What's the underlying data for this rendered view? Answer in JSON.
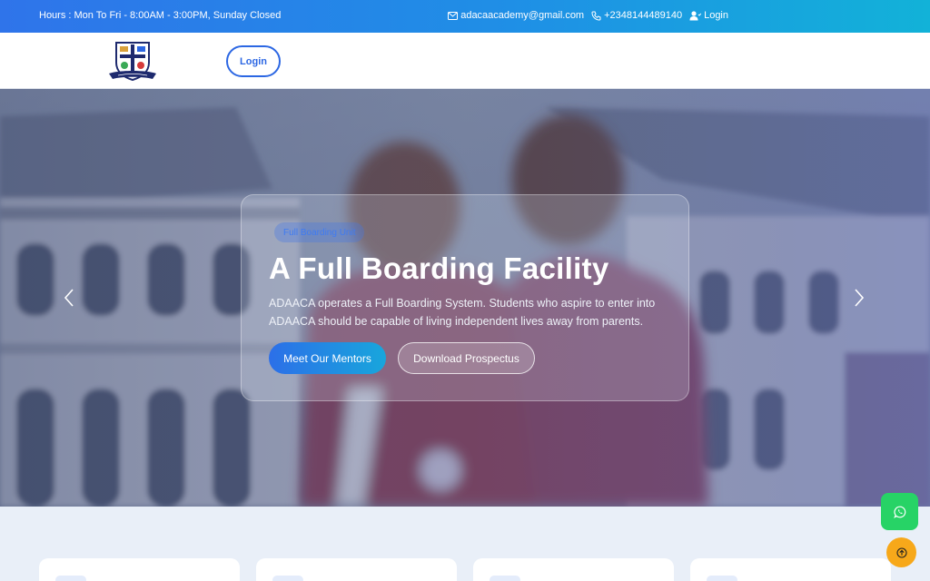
{
  "topbar": {
    "hours": "Hours : Mon To Fri - 8:00AM - 3:00PM, Sunday Closed",
    "email": "adacaacademy@gmail.com",
    "phone": "+2348144489140",
    "login": "Login"
  },
  "header": {
    "login_label": "Login"
  },
  "hero": {
    "tag": "Full Boarding Unit",
    "title": "A Full Boarding Facility",
    "description": "ADAACA operates a Full Boarding System. Students who aspire to enter into ADAACA should be capable of living independent lives away from parents.",
    "primary_button": "Meet Our Mentors",
    "secondary_button": "Download Prospectus"
  },
  "colors": {
    "topbar_start": "#2f74ea",
    "topbar_end": "#12b2d8",
    "accent": "#2c67e3",
    "whatsapp": "#27d366",
    "scroll_top": "#f7a81a"
  },
  "icons": {
    "email": "envelope-icon",
    "phone": "phone-icon",
    "login": "user-icon",
    "prev": "chevron-left-icon",
    "next": "chevron-right-icon",
    "whatsapp": "whatsapp-icon",
    "scroll_top": "arrow-up-icon"
  }
}
